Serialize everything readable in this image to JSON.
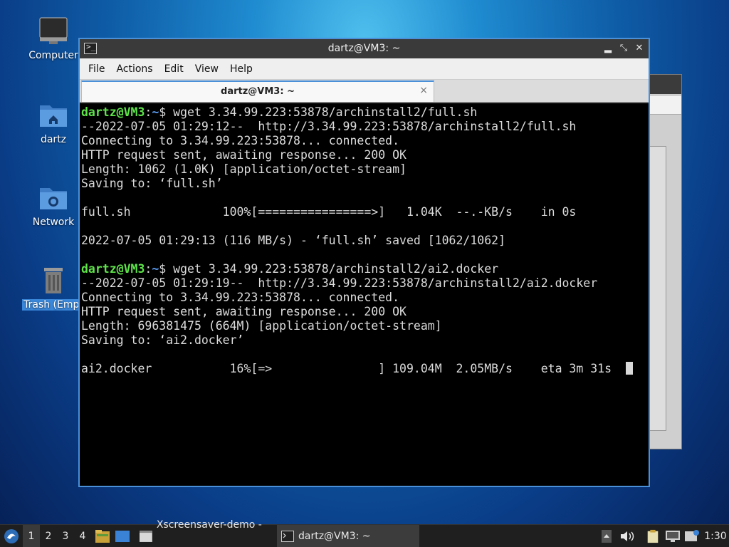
{
  "desktop": {
    "icons": [
      {
        "label": "Computer"
      },
      {
        "label": "dartz"
      },
      {
        "label": "Network"
      },
      {
        "label": "Trash (Empt"
      }
    ]
  },
  "window": {
    "title": "dartz@VM3: ~",
    "menu": [
      "File",
      "Actions",
      "Edit",
      "View",
      "Help"
    ],
    "tab_label": "dartz@VM3: ~",
    "tab_close": "×",
    "controls": {
      "minimize": "▲",
      "maximize": "✕",
      "close": "✕"
    }
  },
  "terminal": {
    "prompt_user": "dartz@VM3",
    "prompt_sep": ":",
    "prompt_path": "~",
    "prompt_end": "$ ",
    "command1": "wget 3.34.99.223:53878/archinstall2/full.sh",
    "output1": [
      "--2022-07-05 01:29:12--  http://3.34.99.223:53878/archinstall2/full.sh",
      "Connecting to 3.34.99.223:53878... connected.",
      "HTTP request sent, awaiting response... 200 OK",
      "Length: 1062 (1.0K) [application/octet-stream]",
      "Saving to: ‘full.sh’",
      "",
      "full.sh             100%[================>]   1.04K  --.-KB/s    in 0s",
      "",
      "2022-07-05 01:29:13 (116 MB/s) - ‘full.sh’ saved [1062/1062]",
      ""
    ],
    "command2": "wget 3.34.99.223:53878/archinstall2/ai2.docker",
    "output2": [
      "--2022-07-05 01:29:19--  http://3.34.99.223:53878/archinstall2/ai2.docker",
      "Connecting to 3.34.99.223:53878... connected.",
      "HTTP request sent, awaiting response... 200 OK",
      "Length: 696381475 (664M) [application/octet-stream]",
      "Saving to: ‘ai2.docker’",
      ""
    ],
    "progress_line": "ai2.docker           16%[=>               ] 109.04M  2.05MB/s    eta 3m 31s  "
  },
  "taskbar": {
    "workspaces": [
      "1",
      "2",
      "3",
      "4"
    ],
    "tasks": [
      {
        "label": "Xscreensaver-demo - ..."
      },
      {
        "label": "dartz@VM3: ~"
      }
    ],
    "clock": "1:30"
  }
}
